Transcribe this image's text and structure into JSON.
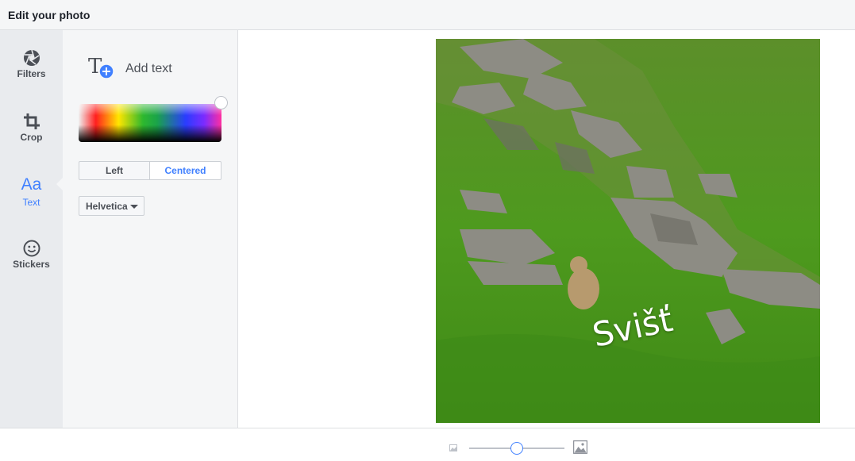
{
  "header": {
    "title": "Edit your photo"
  },
  "rail": {
    "items": [
      {
        "label": "Filters",
        "icon": "aperture-icon"
      },
      {
        "label": "Crop",
        "icon": "crop-icon"
      },
      {
        "label": "Text",
        "icon": "text-aa-icon",
        "glyph": "Aa",
        "active": true
      },
      {
        "label": "Stickers",
        "icon": "smiley-icon"
      }
    ]
  },
  "text_panel": {
    "add_text_label": "Add text",
    "selected_color": "#ffffff",
    "align": {
      "left_label": "Left",
      "centered_label": "Centered",
      "selected": "Centered"
    },
    "font": {
      "selected": "Helvetica"
    }
  },
  "photo": {
    "overlay_text": "Svišť",
    "overlay_color": "#ffffff"
  },
  "zoom": {
    "level": 0.5
  },
  "colors": {
    "accent": "#4080ff",
    "rail_bg": "#e9ebee",
    "panel_bg": "#f5f6f7"
  }
}
